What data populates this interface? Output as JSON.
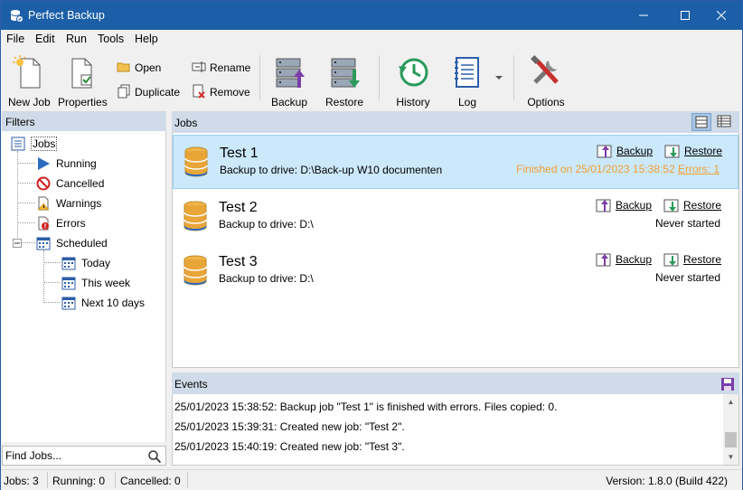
{
  "window": {
    "title": "Perfect Backup"
  },
  "menu": [
    "File",
    "Edit",
    "Run",
    "Tools",
    "Help"
  ],
  "toolbar": {
    "new_job": "New Job",
    "properties": "Properties",
    "open": "Open",
    "duplicate": "Duplicate",
    "rename": "Rename",
    "remove": "Remove",
    "backup": "Backup",
    "restore": "Restore",
    "history": "History",
    "log": "Log",
    "options": "Options"
  },
  "filters": {
    "header": "Filters",
    "items": [
      {
        "label": "Jobs"
      },
      {
        "label": "Running"
      },
      {
        "label": "Cancelled"
      },
      {
        "label": "Warnings"
      },
      {
        "label": "Errors"
      },
      {
        "label": "Scheduled"
      },
      {
        "label": "Today"
      },
      {
        "label": "This week"
      },
      {
        "label": "Next 10 days"
      }
    ],
    "search_placeholder": "Find Jobs..."
  },
  "jobs": {
    "header": "Jobs",
    "items": [
      {
        "name": "Test 1",
        "description": "Backup to drive: D:\\Back-up W10 documenten",
        "backup_label": "Backup",
        "restore_label": "Restore",
        "status": "Finished on 25/01/2023 15:38:52",
        "errors": "Errors: 1",
        "selected": true
      },
      {
        "name": "Test 2",
        "description": "Backup to drive: D:\\",
        "backup_label": "Backup",
        "restore_label": "Restore",
        "status": "Never started",
        "errors": "",
        "selected": false
      },
      {
        "name": "Test 3",
        "description": "Backup to drive: D:\\",
        "backup_label": "Backup",
        "restore_label": "Restore",
        "status": "Never started",
        "errors": "",
        "selected": false
      }
    ]
  },
  "events": {
    "header": "Events",
    "items": [
      "25/01/2023 15:38:52: Backup job \"Test 1\" is finished with errors. Files copied: 0.",
      "25/01/2023 15:39:31: Created new job: \"Test 2\".",
      "25/01/2023 15:40:19: Created new job: \"Test 3\"."
    ]
  },
  "status": {
    "jobs": "Jobs: 3",
    "running": "Running: 0",
    "cancelled": "Cancelled: 0",
    "version": "Version: 1.8.0 (Build 422)"
  },
  "colors": {
    "titlebar": "#1c5fa8",
    "selection": "#cce8fb",
    "panel_header": "#cfdbe8",
    "finished_warning": "#f0a030"
  }
}
